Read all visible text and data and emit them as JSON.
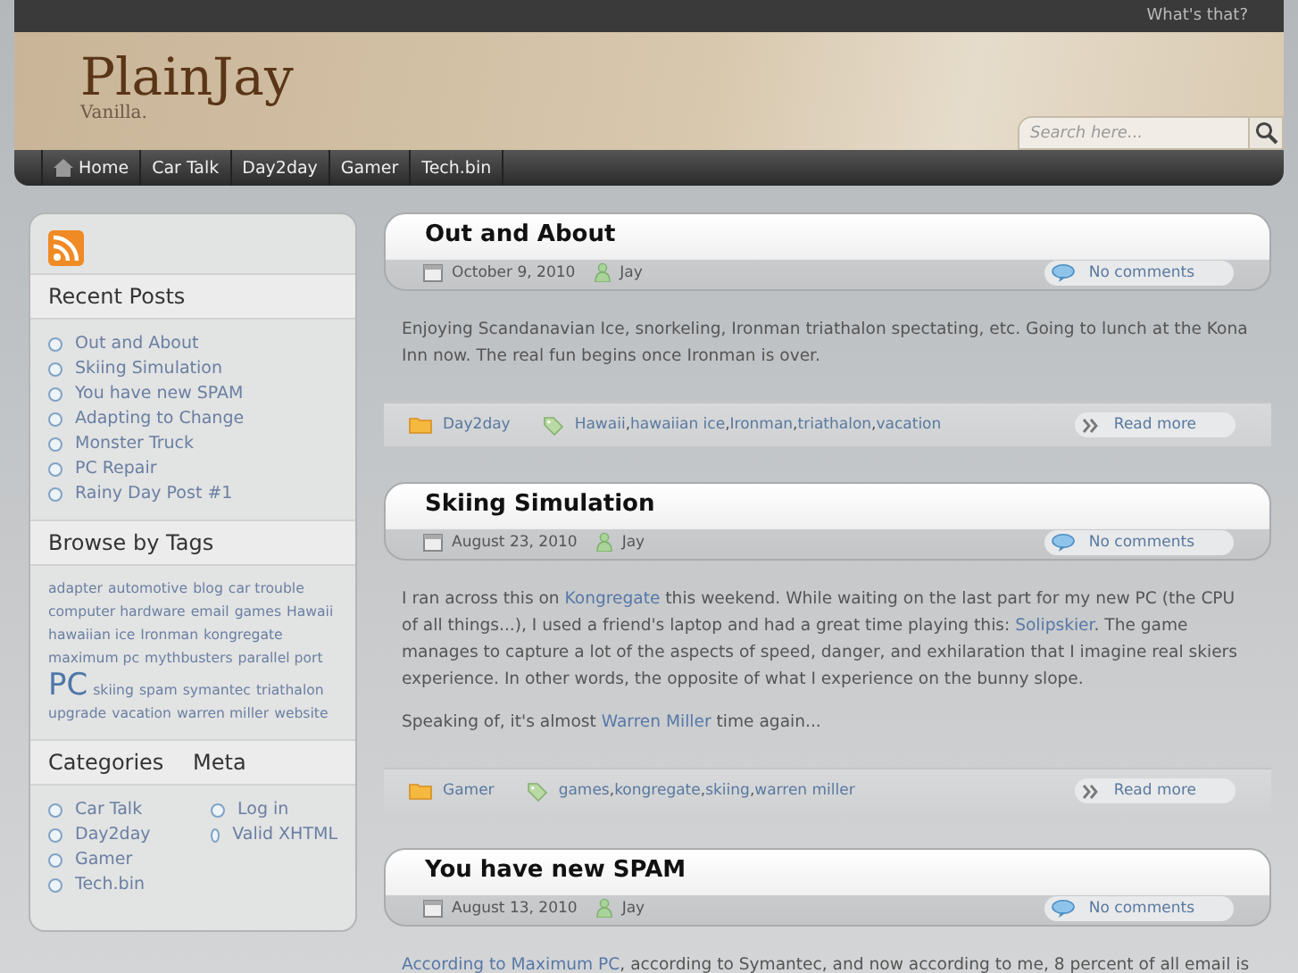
{
  "top_bar": {
    "link": "What's that?"
  },
  "header": {
    "site_title": "PlainJay",
    "tagline": "Vanilla.",
    "search": {
      "placeholder": "Search here..."
    }
  },
  "nav": [
    {
      "label": "Home",
      "kind": "home"
    },
    {
      "label": "Car Talk",
      "kind": "plain"
    },
    {
      "label": "Day2day",
      "kind": "plain"
    },
    {
      "label": "Gamer",
      "kind": "plain"
    },
    {
      "label": "Tech.bin",
      "kind": "plain"
    }
  ],
  "sidebar": {
    "recent_posts": {
      "title": "Recent Posts",
      "items": [
        "Out and About",
        "Skiing Simulation",
        "You have new SPAM",
        "Adapting to Change",
        "Monster Truck",
        "PC Repair",
        "Rainy Day Post #1"
      ]
    },
    "tags": {
      "title": "Browse by Tags",
      "items": [
        {
          "label": "adapter",
          "kind": "normal"
        },
        {
          "label": "automotive",
          "kind": "normal"
        },
        {
          "label": "blog",
          "kind": "normal"
        },
        {
          "label": "car trouble",
          "kind": "normal"
        },
        {
          "label": "computer hardware",
          "kind": "normal"
        },
        {
          "label": "email",
          "kind": "normal"
        },
        {
          "label": "games",
          "kind": "normal"
        },
        {
          "label": "Hawaii",
          "kind": "normal"
        },
        {
          "label": "hawaiian ice",
          "kind": "normal"
        },
        {
          "label": "Ironman",
          "kind": "normal"
        },
        {
          "label": "kongregate",
          "kind": "normal"
        },
        {
          "label": "maximum pc",
          "kind": "normal"
        },
        {
          "label": "mythbusters",
          "kind": "normal"
        },
        {
          "label": "parallel port",
          "kind": "normal"
        },
        {
          "label": "PC",
          "kind": "large"
        },
        {
          "label": "skiing",
          "kind": "normal"
        },
        {
          "label": "spam",
          "kind": "normal"
        },
        {
          "label": "symantec",
          "kind": "normal"
        },
        {
          "label": "triathalon",
          "kind": "normal"
        },
        {
          "label": "upgrade",
          "kind": "normal"
        },
        {
          "label": "vacation",
          "kind": "normal"
        },
        {
          "label": "warren miller",
          "kind": "normal"
        },
        {
          "label": "website",
          "kind": "normal"
        }
      ]
    },
    "categories": {
      "title": "Categories",
      "items": [
        "Car Talk",
        "Day2day",
        "Gamer",
        "Tech.bin"
      ]
    },
    "meta": {
      "title": "Meta",
      "items": [
        "Log in",
        "Valid XHTML"
      ]
    }
  },
  "posts": [
    {
      "title": "Out and About",
      "date": "October 9, 2010",
      "author": "Jay",
      "comments": "No comments",
      "paragraphs": [
        [
          {
            "text": "Enjoying Scandanavian Ice, snorkeling, Ironman triathalon spectating, etc. Going to lunch at the Kona Inn now. The real fun begins once Ironman is over.",
            "link": false
          }
        ]
      ],
      "category": "Day2day",
      "tags": [
        "Hawaii",
        "hawaiian ice",
        "Ironman",
        "triathalon",
        "vacation"
      ],
      "tag_separator": ",",
      "read_more": "Read more"
    },
    {
      "title": "Skiing Simulation",
      "date": "August 23, 2010",
      "author": "Jay",
      "comments": "No comments",
      "paragraphs": [
        [
          {
            "text": "I ran across this on ",
            "link": false
          },
          {
            "text": "Kongregate",
            "link": true
          },
          {
            "text": " this weekend.  While waiting on the last part for my new PC (the CPU of all things...), I used a friend's laptop and had a great time playing this: ",
            "link": false
          },
          {
            "text": "Solipskier",
            "link": true
          },
          {
            "text": ".  The game manages to capture a lot of the aspects of speed, danger, and exhilaration that I imagine real skiers experience. In other words, the opposite of what I experience on the bunny slope.",
            "link": false
          }
        ],
        [
          {
            "text": "Speaking of, it's almost ",
            "link": false
          },
          {
            "text": "Warren Miller",
            "link": true
          },
          {
            "text": " time again...",
            "link": false
          }
        ]
      ],
      "category": "Gamer",
      "tags": [
        "games",
        "kongregate",
        "skiing",
        "warren miller"
      ],
      "tag_separator": ",",
      "read_more": "Read more"
    },
    {
      "title": "You have new SPAM",
      "date": "August 13, 2010",
      "author": "Jay",
      "comments": "No comments",
      "paragraphs": [
        [
          {
            "text": "According to Maximum PC",
            "link": true
          },
          {
            "text": ", according to Symantec, and now according to me, 8 percent of all email is",
            "link": false
          }
        ]
      ]
    }
  ]
}
